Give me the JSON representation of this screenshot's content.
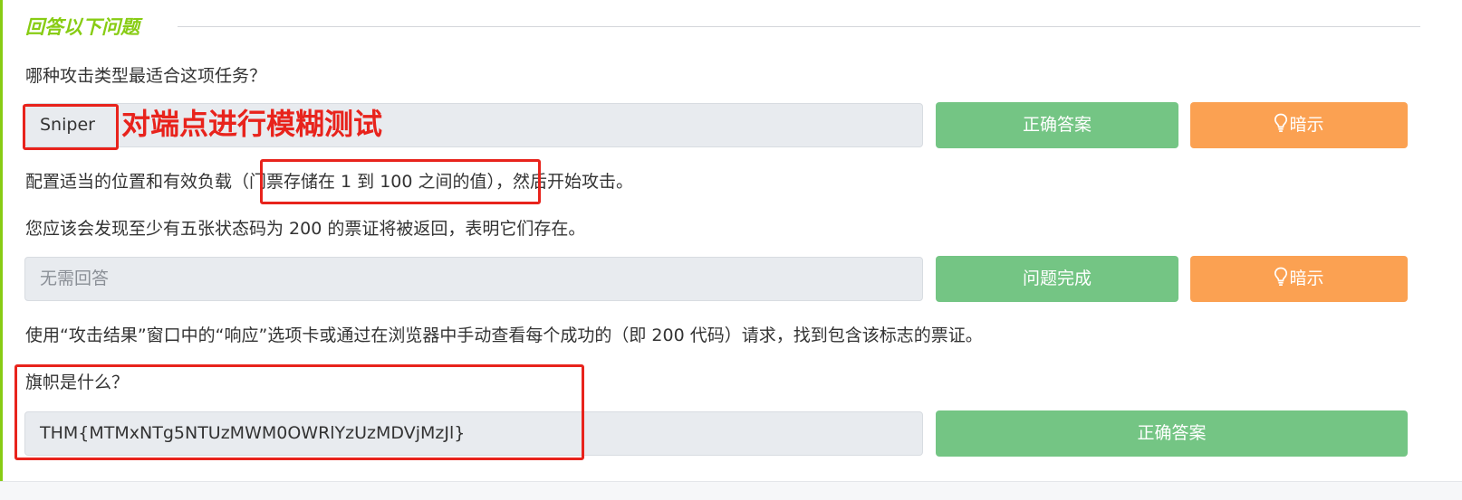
{
  "section": {
    "title": "回答以下问题"
  },
  "questions": [
    {
      "text": "哪种攻击类型最适合这项任务？",
      "answer_value": "Sniper",
      "annotation": "对端点进行模糊测试",
      "submit_label": "正确答案",
      "hint_label": "暗示",
      "hint_icon": "lightbulb-icon"
    },
    {
      "text_before": "配置适当的位置和有效负载",
      "text_boxed": "（门票存储在 1 到 100 之间的值）",
      "text_after": "，然后开始攻击。",
      "text_line2": "您应该会发现至少有五张状态码为 200 的票证将被返回，表明它们存在。",
      "answer_placeholder": "无需回答",
      "submit_label": "问题完成",
      "hint_label": "暗示",
      "hint_icon": "lightbulb-icon"
    },
    {
      "text_instruction": "使用“攻击结果”窗口中的“响应”选项卡或通过在浏览器中手动查看每个成功的（即 200 代码）请求，找到包含该标志的票证。",
      "text": "旗帜是什么？",
      "answer_value": "THM{MTMxNTg5NTUzMWM0OWRlYzUzMDVjMzJl}",
      "submit_label": "正确答案"
    }
  ],
  "colors": {
    "accent_green": "#88cc14",
    "button_green": "#74c584",
    "button_orange": "#fba152",
    "annotation_red": "#e8231c"
  }
}
